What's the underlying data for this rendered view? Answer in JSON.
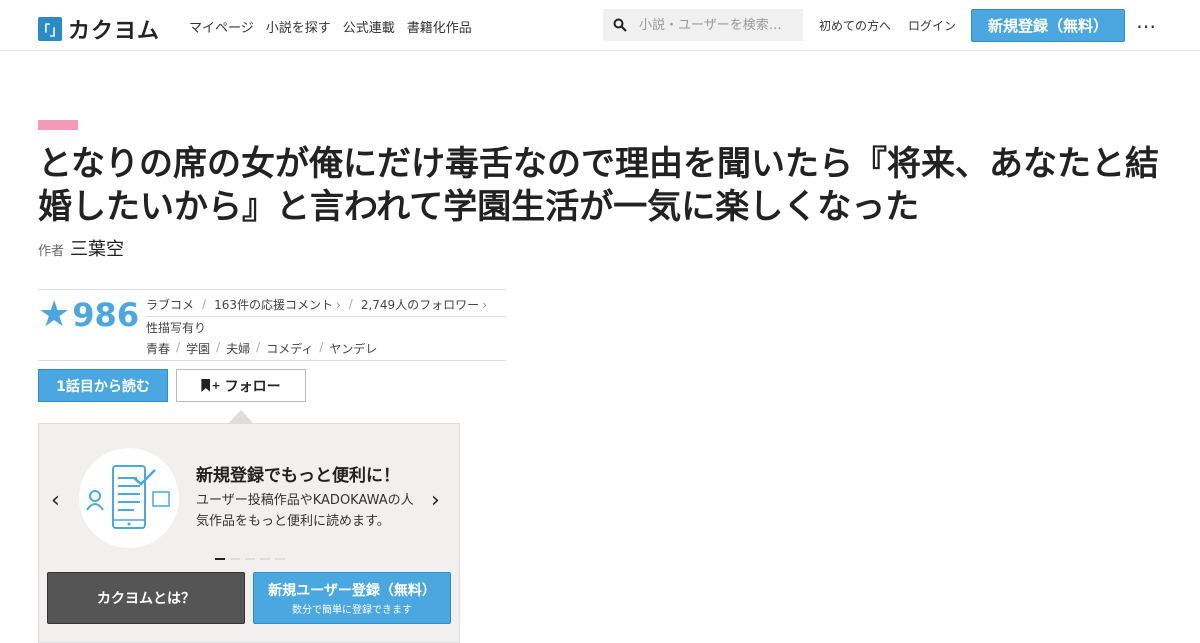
{
  "header": {
    "logo_mark": "「」",
    "logo_text": "カクヨム",
    "nav": [
      "マイページ",
      "小説を探す",
      "公式連載",
      "書籍化作品"
    ],
    "search_placeholder": "小説・ユーザーを検索…",
    "beginners_link": "初めての方へ",
    "login_link": "ログイン",
    "signup_button": "新規登録（無料）",
    "more_icon": "⋯"
  },
  "work": {
    "genre_color": "#f49ab8",
    "title": "となりの席の女が俺にだけ毒舌なので理由を聞いたら『将来、あなたと結婚したいから』と言われて学園生活が一気に楽しくなった",
    "author_label": "作者",
    "author_name": "三葉空",
    "stars": "986",
    "genre": "ラブコメ",
    "comments": "163件の応援コメント",
    "followers": "2,749人のフォロワー",
    "warning": "性描写有り",
    "tags": [
      "青春",
      "学園",
      "夫婦",
      "コメディ",
      "ヤンデレ"
    ],
    "read_button": "1話目から読む",
    "follow_button": "フォロー"
  },
  "promo": {
    "title": "新規登録でもっと便利に！",
    "text": "ユーザー投稿作品やKADOKAWAの人気作品をもっと便利に読めます。",
    "slide_count": 5,
    "active_slide": 1,
    "about_button": "カクヨムとは？",
    "register_button": "新規ユーザー登録（無料）",
    "register_sub": "数分で簡単に登録できます"
  },
  "colors": {
    "accent": "#4aa7e0",
    "dark_button": "#555555",
    "promo_bg": "#f2f0ee"
  }
}
